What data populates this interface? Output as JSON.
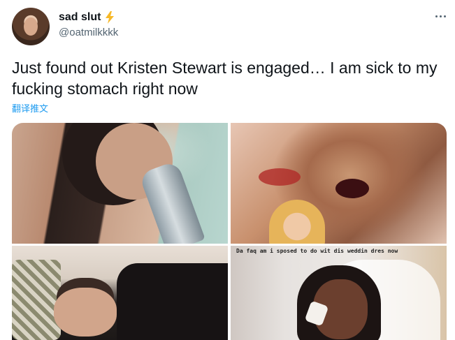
{
  "author": {
    "display_name": "sad slut",
    "badge_icon": "lightning-bolt-icon",
    "handle": "@oatmilkkkk"
  },
  "menu": {
    "icon": "more-horizontal-icon"
  },
  "tweet": {
    "text": "Just found out Kristen Stewart is engaged… I am sick to my fucking stomach right now",
    "translate_label": "翻译推文"
  },
  "media": {
    "photo_4_caption": "Da faq am i sposed to do wit dis weddin dres now"
  },
  "colors": {
    "text": "#0f1419",
    "secondary": "#536471",
    "link": "#1d9bf0",
    "bolt": "#f7b928"
  }
}
